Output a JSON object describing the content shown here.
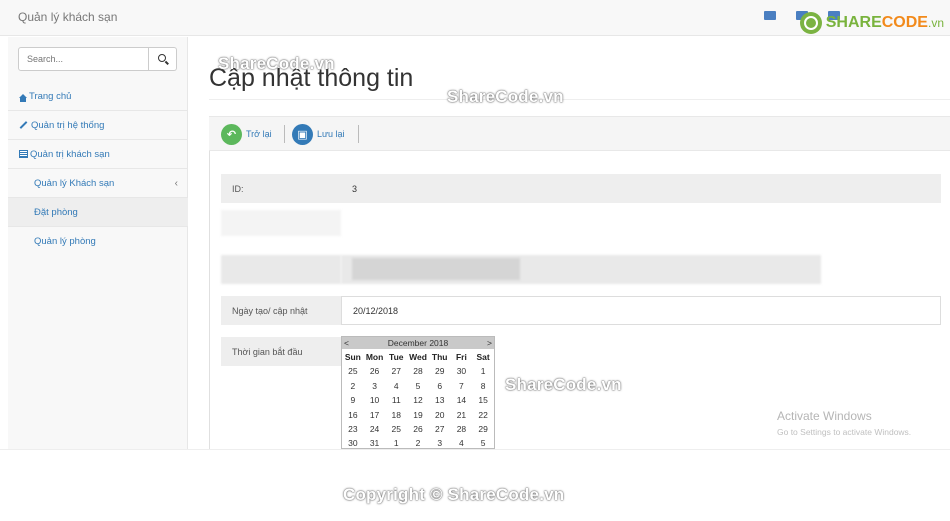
{
  "app": {
    "title": "Quản lý khách sạn"
  },
  "logo": {
    "share": "SHARE",
    "code": "CODE",
    "vn": ".vn"
  },
  "search": {
    "placeholder": "Search..."
  },
  "sidebar": {
    "items": [
      {
        "label": "Trang chủ",
        "icon": "home-icon"
      },
      {
        "label": "Quản trị hệ thống",
        "icon": "wrench-icon"
      },
      {
        "label": "Quản trị khách sạn",
        "icon": "table-icon"
      },
      {
        "label": "Quản lý Khách sạn",
        "chevron": "‹"
      },
      {
        "label": "Đặt phòng"
      },
      {
        "label": "Quản lý phòng"
      }
    ]
  },
  "page": {
    "title": "Cập nhật thông tin"
  },
  "toolbar": {
    "back_label": "Trở lại",
    "save_label": "Lưu lại"
  },
  "form": {
    "id_label": "ID:",
    "id_value": "3",
    "date_label": "Ngày tạo/ cập nhật",
    "date_value": "20/12/2018",
    "start_label": "Thời gian bắt đầu"
  },
  "calendar": {
    "prev": "<",
    "next": ">",
    "month_title": "December 2018",
    "weekdays": [
      "Sun",
      "Mon",
      "Tue",
      "Wed",
      "Thu",
      "Fri",
      "Sat"
    ],
    "days": [
      "25",
      "26",
      "27",
      "28",
      "29",
      "30",
      "1",
      "2",
      "3",
      "4",
      "5",
      "6",
      "7",
      "8",
      "9",
      "10",
      "11",
      "12",
      "13",
      "14",
      "15",
      "16",
      "17",
      "18",
      "19",
      "20",
      "21",
      "22",
      "23",
      "24",
      "25",
      "26",
      "27",
      "28",
      "29",
      "30",
      "31",
      "1",
      "2",
      "3",
      "4",
      "5"
    ]
  },
  "watermarks": {
    "a": "ShareCode.vn",
    "b": "ShareCode.vn",
    "c": "ShareCode.vn",
    "copyright": "Copyright © ShareCode.vn"
  },
  "activate": {
    "title": "Activate Windows",
    "subtitle": "Go to Settings to activate Windows."
  },
  "colors": {
    "link": "#337ab7",
    "back_button": "#5cb85c",
    "save_button": "#337ab7",
    "logo_green": "#79b33d",
    "logo_orange": "#f28a1b"
  }
}
